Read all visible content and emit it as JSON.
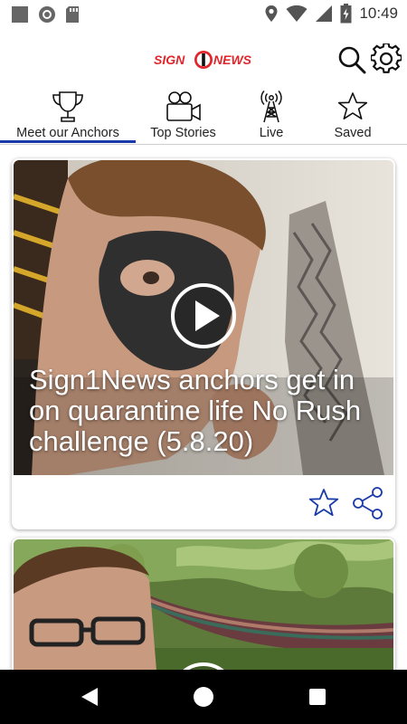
{
  "status_bar": {
    "time": "10:49",
    "left_icons": [
      "stop-icon",
      "record-icon",
      "sd-card-icon"
    ],
    "right_icons": [
      "location-icon",
      "wifi-icon",
      "signal-icon",
      "battery-charging-icon"
    ]
  },
  "header": {
    "logo_text_left": "SIGN",
    "logo_text_right": "NEWS",
    "logo_mark": "1",
    "brand_color": "#e0262c",
    "search_icon": "search-icon",
    "settings_icon": "gear-icon"
  },
  "tabs": [
    {
      "label": "Meet our Anchors",
      "icon": "trophy-icon",
      "active": true
    },
    {
      "label": "Top Stories",
      "icon": "video-camera-icon",
      "active": false
    },
    {
      "label": "Live",
      "icon": "broadcast-tower-icon",
      "active": false
    },
    {
      "label": "Saved",
      "icon": "star-icon",
      "active": false
    }
  ],
  "accent_color": "#1a3aa8",
  "feed": {
    "cards": [
      {
        "title": "Sign1News anchors get in on quarantine life No Rush challenge (5.8.20)",
        "play_icon": "play-icon",
        "actions": [
          "star-icon",
          "share-icon"
        ]
      },
      {
        "title": "",
        "play_icon": "play-icon"
      }
    ]
  },
  "nav_bar": {
    "icons": [
      "back-icon",
      "home-icon",
      "recents-icon"
    ]
  }
}
